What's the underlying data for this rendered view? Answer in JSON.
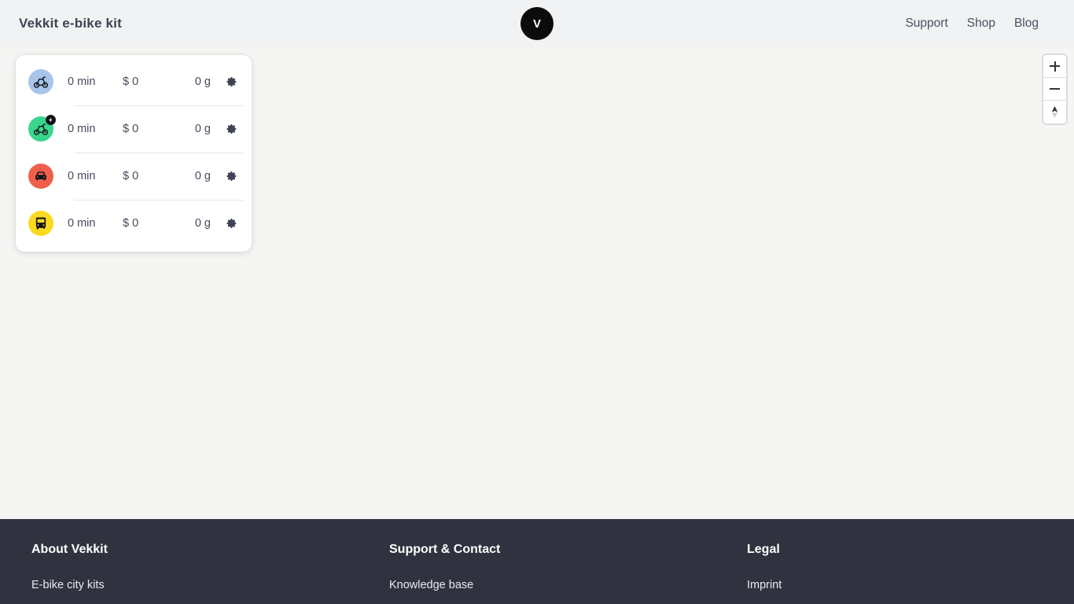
{
  "header": {
    "brand_title": "Vekkit e-bike kit",
    "logo_letter": "V",
    "nav": [
      {
        "label": "Support",
        "name": "nav-link-support"
      },
      {
        "label": "Shop",
        "name": "nav-link-shop"
      },
      {
        "label": "Blog",
        "name": "nav-link-blog"
      }
    ]
  },
  "modes_card": {
    "rows": [
      {
        "mode": "bicycle",
        "icon": "bicycle-icon",
        "icon_bg": "#a8c4e8",
        "badge": null,
        "duration": "0 min",
        "cost": "$ 0",
        "co2": "0 g",
        "settings_icon": "gear-icon"
      },
      {
        "mode": "e-bike",
        "icon": "electric-bicycle-icon",
        "icon_bg": "#3ad68f",
        "badge": "lightning-bolt-badge",
        "duration": "0 min",
        "cost": "$ 0",
        "co2": "0 g",
        "settings_icon": "gear-icon"
      },
      {
        "mode": "car",
        "icon": "car-icon",
        "icon_bg": "#ef5f4c",
        "badge": null,
        "duration": "0 min",
        "cost": "$ 0",
        "co2": "0 g",
        "settings_icon": "gear-icon"
      },
      {
        "mode": "bus",
        "icon": "bus-icon",
        "icon_bg": "#fada1e",
        "badge": null,
        "duration": "0 min",
        "cost": "$ 0",
        "co2": "0 g",
        "settings_icon": "gear-icon"
      }
    ]
  },
  "map_controls": {
    "zoom_in": "zoom-in-icon",
    "zoom_out": "zoom-out-icon",
    "compass": "compass-icon"
  },
  "footer": {
    "columns": [
      {
        "heading": "About Vekkit",
        "links": [
          {
            "label": "E-bike city kits"
          }
        ]
      },
      {
        "heading": "Support & Contact",
        "links": [
          {
            "label": "Knowledge base"
          }
        ]
      },
      {
        "heading": "Legal",
        "links": [
          {
            "label": "Imprint"
          }
        ]
      }
    ]
  },
  "colors": {
    "page_bg": "#f5f5f3",
    "header_bg": "#f1f2f3",
    "footer_bg": "#30333f",
    "text": "#3d4352",
    "card_bg": "#ffffff"
  }
}
